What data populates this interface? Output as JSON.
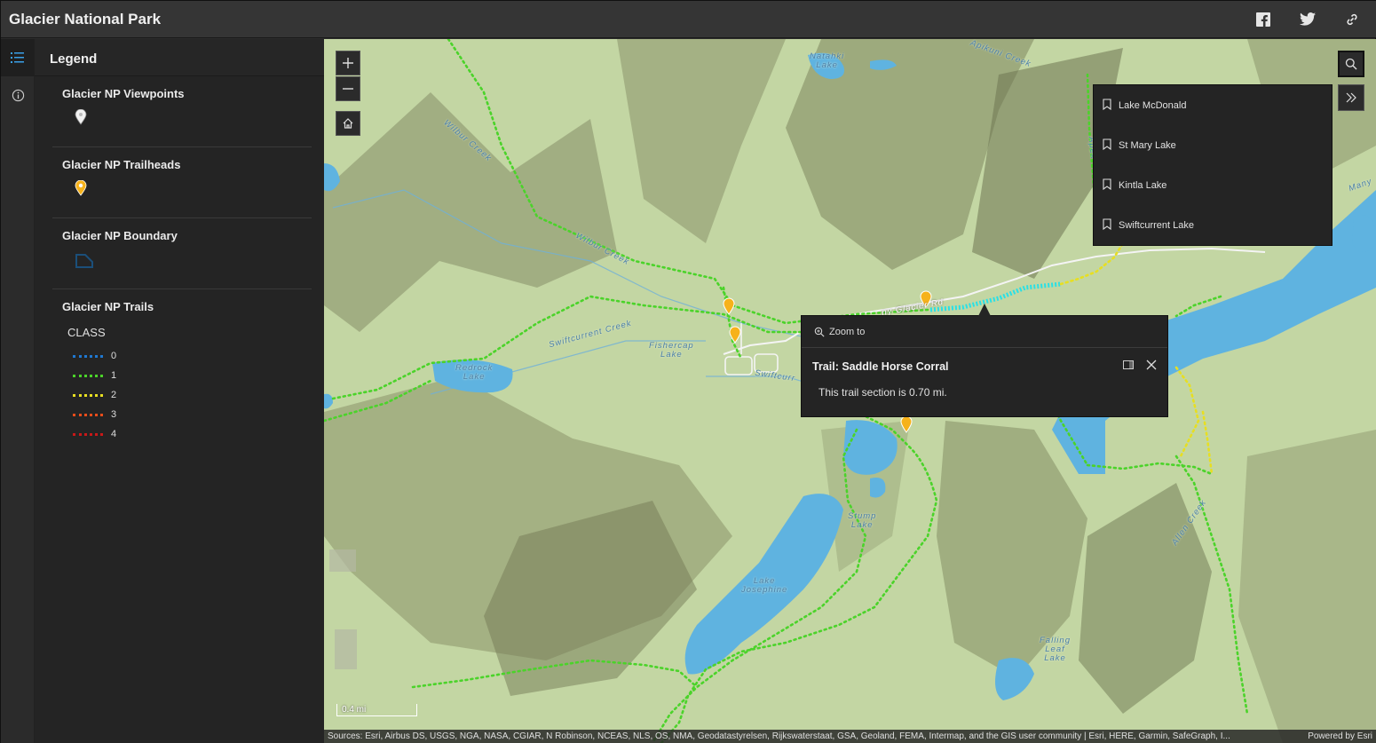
{
  "header": {
    "title": "Glacier National Park"
  },
  "legend": {
    "title": "Legend",
    "layers": [
      {
        "name": "Glacier NP Viewpoints"
      },
      {
        "name": "Glacier NP Trailheads"
      },
      {
        "name": "Glacier NP Boundary"
      },
      {
        "name": "Glacier NP Trails"
      }
    ],
    "class_label": "CLASS",
    "trail_classes": [
      {
        "label": "0",
        "color": "#1f78d1"
      },
      {
        "label": "1",
        "color": "#4bd32a"
      },
      {
        "label": "2",
        "color": "#e7df22"
      },
      {
        "label": "3",
        "color": "#e84c1b"
      },
      {
        "label": "4",
        "color": "#c81818"
      }
    ]
  },
  "bookmarks": [
    {
      "label": "Lake McDonald"
    },
    {
      "label": "St Mary Lake"
    },
    {
      "label": "Kintla Lake"
    },
    {
      "label": "Swiftcurrent Lake"
    }
  ],
  "popup": {
    "zoom_label": "Zoom to",
    "title": "Trail:  Saddle Horse Corral",
    "body": "This trail section is 0.70 mi."
  },
  "map": {
    "scale_label": "0.4 mi",
    "attribution": "Sources: Esri, Airbus DS, USGS, NGA, NASA, CGIAR, N Robinson, NCEAS, NLS, OS, NMA, Geodatastyrelsen, Rijkswaterstaat, GSA, Geoland, FEMA, Intermap, and the GIS user community | Esri, HERE, Garmin, SafeGraph, I...",
    "powered_by": "Powered by Esri",
    "labels": {
      "natahki": "Natahki\nLake",
      "apikuni": "Apikuni Creek",
      "wilbur1": "Wilbur Creek",
      "wilbur2": "Wilbur Creek",
      "swiftcurrent_creek": "Swiftcurrent Creek",
      "fishercap": "Fishercap\nLake",
      "redrock": "Redrock\nLake",
      "swiftcurrent_road": "Swiftcurr",
      "glacier_rd": "ny Glacier Rd",
      "stump": "Stump\nLake",
      "josephine": "Lake\nJosephine",
      "falling_leaf": "Falling\nLeaf\nLake",
      "allen": "Allen Creek",
      "many": "Many",
      "apek": "Apek"
    },
    "colors": {
      "terrain": "#c5d8a6",
      "water": "#5fb3e0",
      "trail": "#4bd32a",
      "trail_yellow": "#e7df22",
      "highlight": "#29e0e6"
    }
  }
}
